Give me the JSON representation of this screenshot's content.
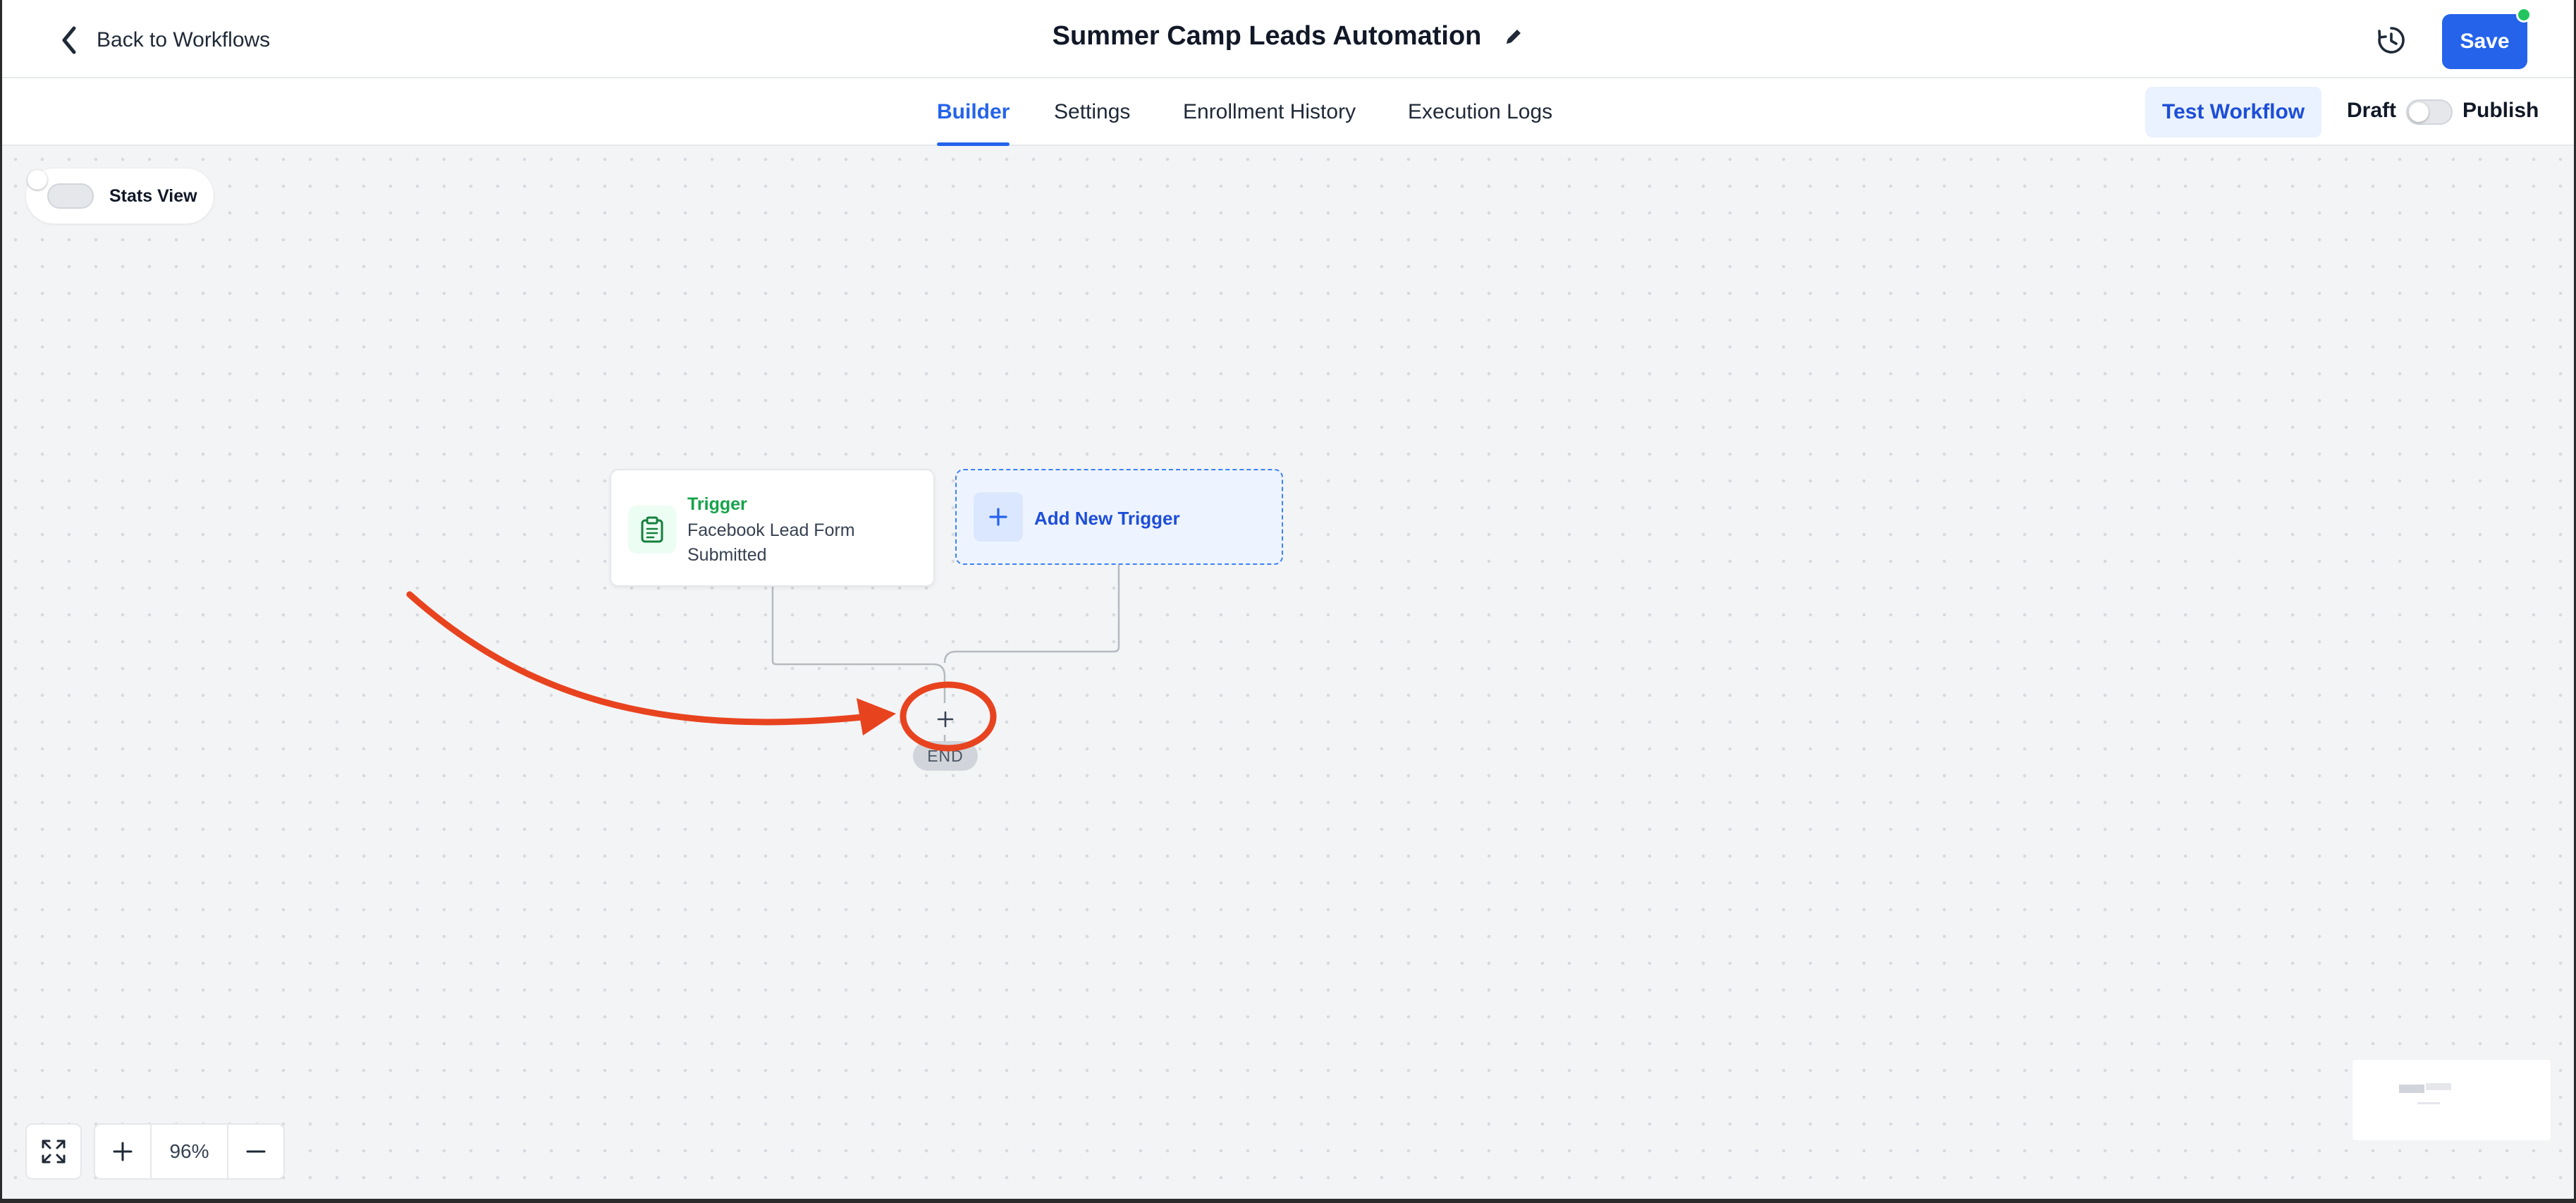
{
  "header": {
    "back_label": "Back to Workflows",
    "title": "Summer Camp Leads Automation",
    "save_label": "Save"
  },
  "tabs": [
    {
      "label": "Builder",
      "active": true
    },
    {
      "label": "Settings",
      "active": false
    },
    {
      "label": "Enrollment History",
      "active": false
    },
    {
      "label": "Execution Logs",
      "active": false
    }
  ],
  "actions": {
    "test_label": "Test Workflow",
    "draft_label": "Draft",
    "publish_label": "Publish",
    "published": false
  },
  "canvas": {
    "stats_label": "Stats View",
    "stats_enabled": false,
    "trigger": {
      "label": "Trigger",
      "text": "Facebook Lead Form Submitted"
    },
    "add_trigger_label": "Add New Trigger",
    "end_label": "END",
    "zoom": "96%"
  },
  "icons": {
    "back": "chevron-left-icon",
    "edit": "pencil-icon",
    "history": "history-clock-icon",
    "trigger": "clipboard-icon",
    "add": "plus-icon",
    "fit": "expand-icon",
    "zoom_in": "plus-icon",
    "zoom_out": "minus-icon"
  },
  "colors": {
    "primary": "#2563eb",
    "trigger_green": "#16a34a",
    "annotation": "#e8431f",
    "online_dot": "#22c55e"
  }
}
